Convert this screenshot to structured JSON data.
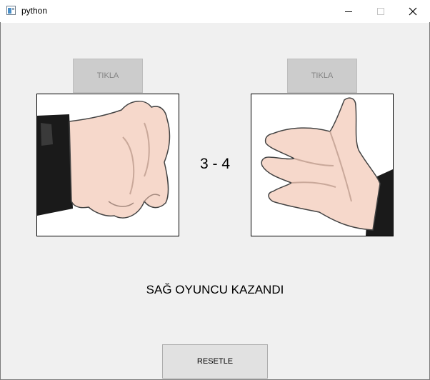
{
  "window": {
    "title": "python"
  },
  "left_player": {
    "button_label": "TIKLA",
    "hand_icon": "rock-hand-icon"
  },
  "right_player": {
    "button_label": "TIKLA",
    "hand_icon": "paper-hand-icon"
  },
  "score": {
    "text": "3 - 4"
  },
  "result": {
    "text": "SAĞ OYUNCU KAZANDI"
  },
  "reset": {
    "label": "RESETLE"
  },
  "colors": {
    "skin": "#f7d9cc",
    "sleeve": "#1a1a1a",
    "button_disabled": "#cccccc"
  }
}
